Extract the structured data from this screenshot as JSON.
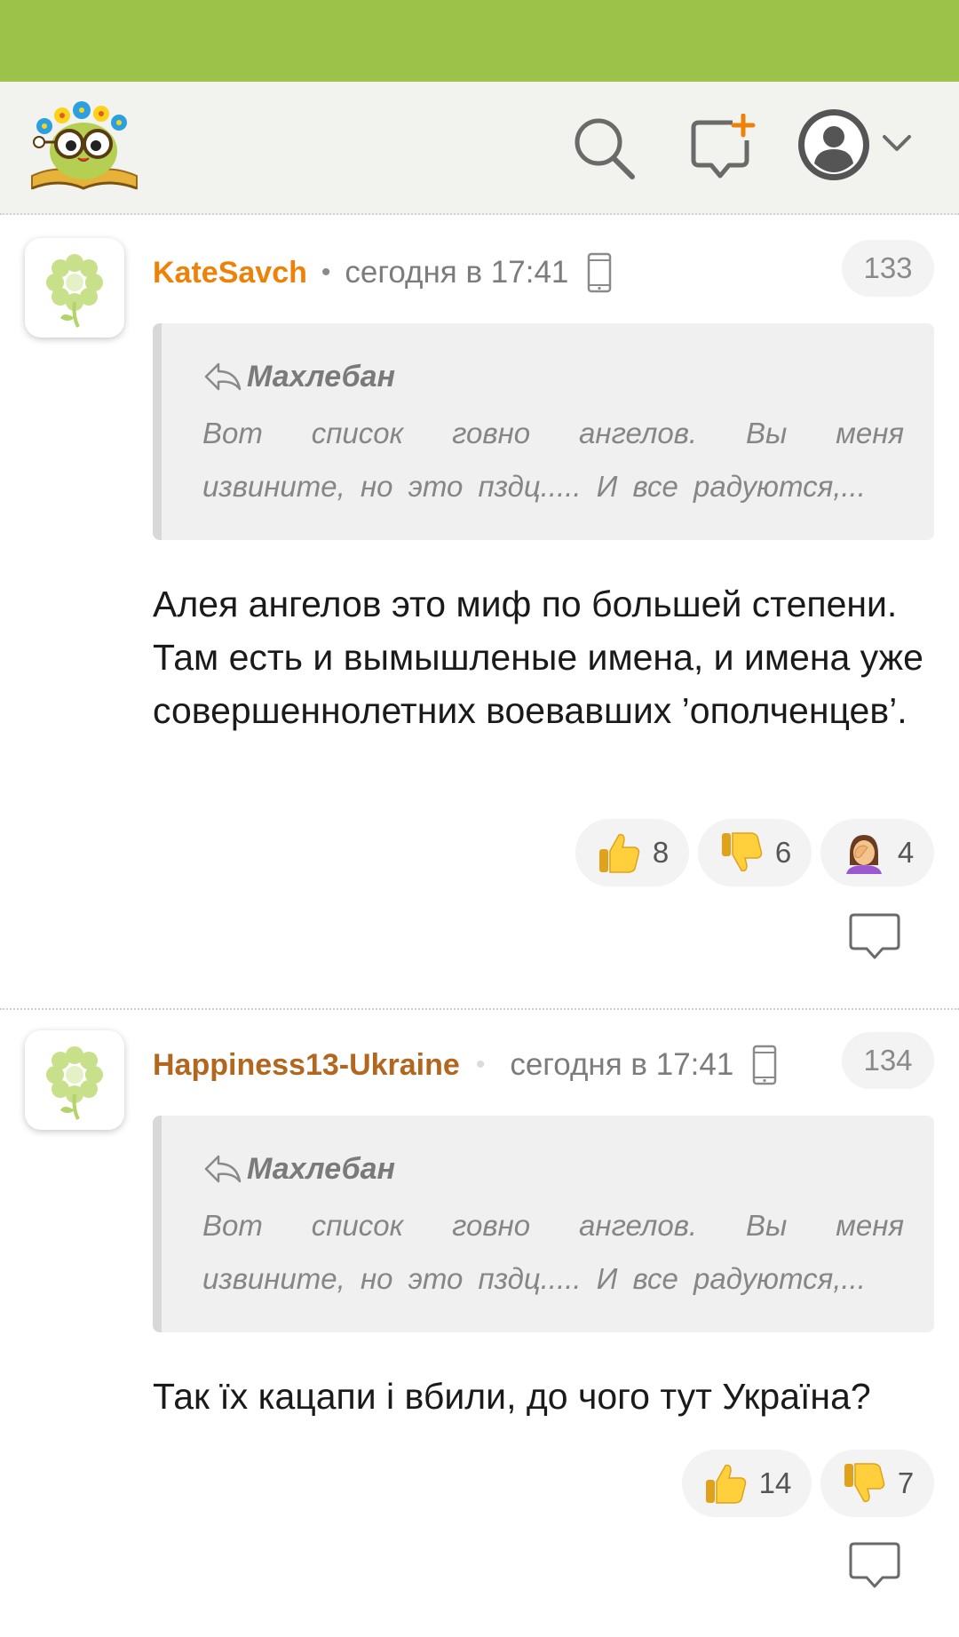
{
  "app": {
    "header": {
      "logo_icon": "smiling-owl-book-logo",
      "search_icon": "search-icon",
      "compose_icon": "new-comment-icon",
      "profile_icon": "profile-avatar-icon",
      "menu_icon": "chevron-down-icon"
    },
    "colors": {
      "status_bar": "#9cc24a",
      "author_primary": "#ee8208",
      "author_secondary": "#b2661e"
    }
  },
  "comments": [
    {
      "author": "KateSavch",
      "separator": "•",
      "time": "сегодня в 17:41",
      "device_icon": "mobile-phone-icon",
      "number": "133",
      "quote": {
        "author": "Махлебан",
        "line1": "Вот список говно ангелов. Вы меня",
        "line2": "извините, но это пздц..... И все радуются,..."
      },
      "text": "Алея ангелов это миф по большей степени. Там есть и вымышленые имена, и имена уже совершеннолетних воевавших ’ополченцев’.",
      "reactions": [
        {
          "icon": "thumbs-up-icon",
          "count": "8"
        },
        {
          "icon": "thumbs-down-icon",
          "count": "6"
        },
        {
          "icon": "facepalm-icon",
          "count": "4"
        }
      ],
      "reply_icon": "reply-bubble-icon"
    },
    {
      "author": "Happiness13-Ukraine",
      "separator": "•",
      "time": "сегодня в 17:41",
      "device_icon": "mobile-phone-icon",
      "number": "134",
      "quote": {
        "author": "Махлебан",
        "line1": "Вот список говно ангелов. Вы меня",
        "line2": "извините, но это пздц..... И все радуются,..."
      },
      "text": "Так їх кацапи і вбили, до чого тут Україна?",
      "reactions": [
        {
          "icon": "thumbs-up-icon",
          "count": "14"
        },
        {
          "icon": "thumbs-down-icon",
          "count": "7"
        }
      ],
      "reply_icon": "reply-bubble-icon"
    }
  ]
}
